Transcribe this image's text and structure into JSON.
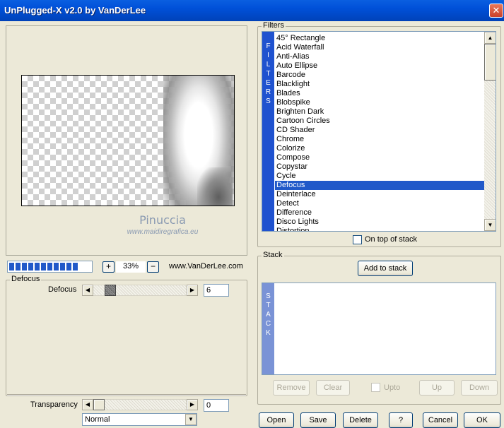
{
  "window": {
    "title": "UnPlugged-X v2.0 by VanDerLee",
    "close_icon": "close-icon"
  },
  "preview": {
    "watermark_name": "Pinuccia",
    "watermark_url": "www.maidiregrafica.eu"
  },
  "zoom": {
    "zoom_in": "+",
    "value": "33%",
    "zoom_out": "−",
    "site": "www.VanDerLee.com",
    "progress_segments": 11
  },
  "params": {
    "group_title": "Defocus",
    "defocus_label": "Defocus",
    "defocus_value": "6",
    "transparency_label": "Transparency",
    "transparency_value": "0",
    "blend_mode": "Normal"
  },
  "filters": {
    "group_title": "Filters",
    "side_tab": "F I L T E R S",
    "items": [
      "45° Rectangle",
      "Acid Waterfall",
      "Anti-Alias",
      "Auto Ellipse",
      "Barcode",
      "Blacklight",
      "Blades",
      "Blobspike",
      "Brighten Dark",
      "Cartoon Circles",
      "CD Shader",
      "Chrome",
      "Colorize",
      "Compose",
      "Copystar",
      "Cycle",
      "Defocus",
      "Deinterlace",
      "Detect",
      "Difference",
      "Disco Lights",
      "Distortion"
    ],
    "selected": "Defocus",
    "on_top_label": "On top of stack"
  },
  "stack": {
    "group_title": "Stack",
    "add_button": "Add to stack",
    "side_tab": "S T A C K",
    "remove": "Remove",
    "clear": "Clear",
    "upto": "Upto",
    "up": "Up",
    "down": "Down"
  },
  "footer": {
    "open": "Open",
    "save": "Save",
    "delete": "Delete",
    "help": "?",
    "cancel": "Cancel",
    "ok": "OK"
  },
  "colors": {
    "title_bar": "#0054e3",
    "selection": "#2159c9",
    "face": "#ece9d8"
  }
}
